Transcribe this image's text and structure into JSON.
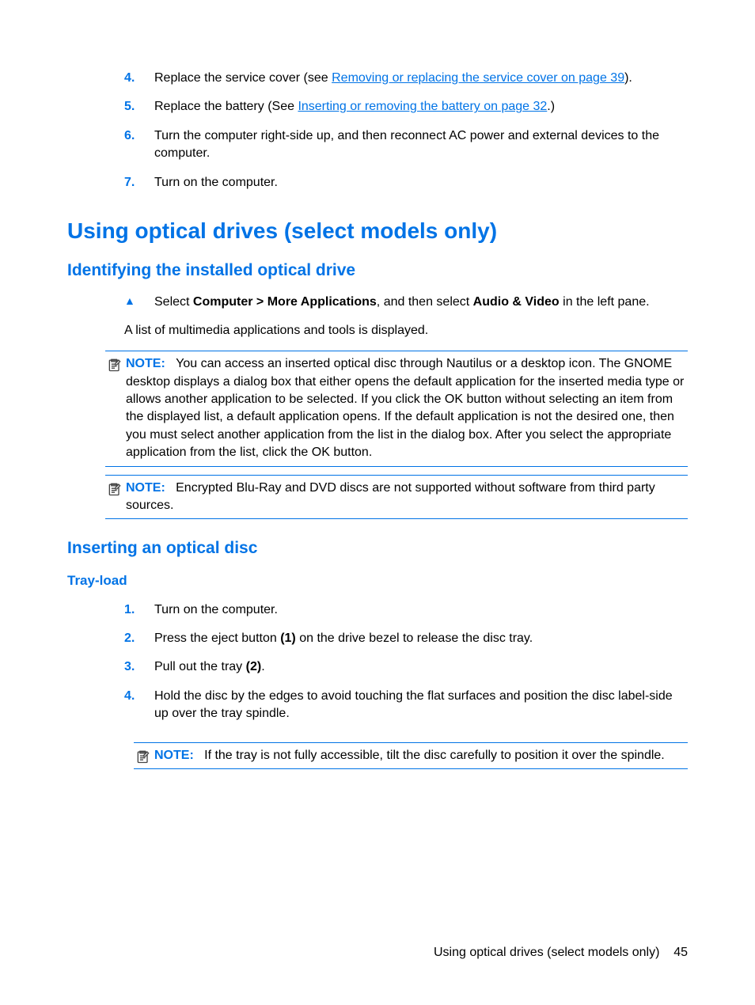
{
  "top_list": [
    {
      "num": "4.",
      "pre": "Replace the service cover (see ",
      "link": "Removing or replacing the service cover on page 39",
      "post": ")."
    },
    {
      "num": "5.",
      "pre": "Replace the battery (See ",
      "link": "Inserting or removing the battery on page 32",
      "post": ".)"
    },
    {
      "num": "6.",
      "text": "Turn the computer right-side up, and then reconnect AC power and external devices to the computer."
    },
    {
      "num": "7.",
      "text": "Turn on the computer."
    }
  ],
  "h1": "Using optical drives (select models only)",
  "h2a": "Identifying the installed optical drive",
  "tri_pre": "Select ",
  "tri_b1": "Computer > More Applications",
  "tri_mid": ", and then select ",
  "tri_b2": "Audio & Video",
  "tri_post": " in the left pane.",
  "para1": "A list of multimedia applications and tools is displayed.",
  "note_label": "NOTE:",
  "note1": "You can access an inserted optical disc through Nautilus or a desktop icon. The GNOME desktop displays a dialog box that either opens the default application for the inserted media type or allows another application to be selected. If you click the OK button without selecting an item from the displayed list, a default application opens. If the default application is not the desired one, then you must select another application from the list in the dialog box. After you select the appropriate application from the list, click the OK button.",
  "note2": "Encrypted Blu-Ray and DVD discs are not supported without software from third party sources.",
  "h2b": "Inserting an optical disc",
  "h3": "Tray-load",
  "steps": [
    {
      "num": "1.",
      "text": "Turn on the computer."
    },
    {
      "num": "2.",
      "pre": "Press the eject button ",
      "b": "(1)",
      "post": " on the drive bezel to release the disc tray."
    },
    {
      "num": "3.",
      "pre": "Pull out the tray ",
      "b": "(2)",
      "post": "."
    },
    {
      "num": "4.",
      "text": "Hold the disc by the edges to avoid touching the flat surfaces and position the disc label-side up over the tray spindle."
    }
  ],
  "note3": "If the tray is not fully accessible, tilt the disc carefully to position it over the spindle.",
  "footer_text": "Using optical drives (select models only)",
  "footer_page": "45"
}
